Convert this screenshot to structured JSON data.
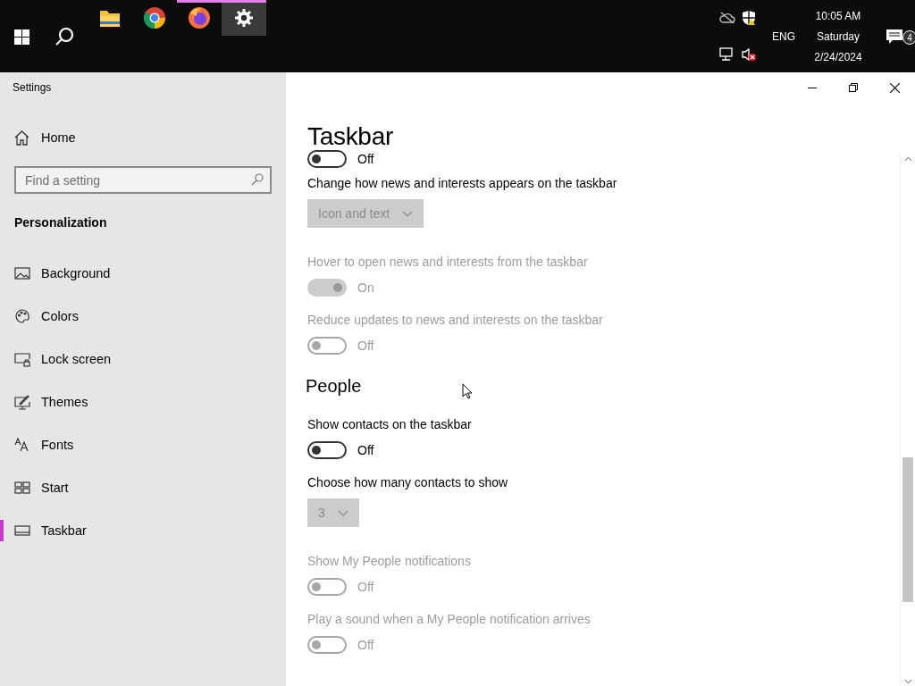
{
  "taskbar": {
    "apps": [
      {
        "kind": "explorer",
        "running": false,
        "active": false
      },
      {
        "kind": "chrome",
        "running": false,
        "active": false
      },
      {
        "kind": "firefox",
        "running": true,
        "active": false
      },
      {
        "kind": "settings",
        "running": true,
        "active": true
      }
    ],
    "tray": {
      "language": "ENG",
      "time": "10:05 AM",
      "day": "Saturday",
      "date": "2/24/2024",
      "notification_count": "4"
    }
  },
  "window": {
    "title": "Settings"
  },
  "sidebar": {
    "home": "Home",
    "search": {
      "placeholder": "Find a setting"
    },
    "section": "Personalization",
    "items": [
      {
        "kind": "background",
        "label": "Background",
        "selected": false
      },
      {
        "kind": "colors",
        "label": "Colors",
        "selected": false
      },
      {
        "kind": "lock",
        "label": "Lock screen",
        "selected": false
      },
      {
        "kind": "themes",
        "label": "Themes",
        "selected": false
      },
      {
        "kind": "fonts",
        "label": "Fonts",
        "selected": false
      },
      {
        "kind": "start",
        "label": "Start",
        "selected": false
      },
      {
        "kind": "taskbar",
        "label": "Taskbar",
        "selected": true
      }
    ]
  },
  "content": {
    "title": "Taskbar",
    "settings": [
      {
        "kind": "toggle",
        "on": false,
        "disabled": false,
        "state_text": "Off"
      },
      {
        "kind": "dropdown",
        "label": "Change how news and interests appears on the taskbar",
        "value": "Icon and text",
        "disabled": true
      },
      {
        "kind": "toggle",
        "label": "Hover to open news and interests from the taskbar",
        "on": true,
        "disabled": true,
        "state_text": "On"
      },
      {
        "kind": "toggle",
        "label": "Reduce updates to news and interests on the taskbar",
        "on": false,
        "disabled": true,
        "state_text": "Off"
      },
      {
        "kind": "heading",
        "label": "People"
      },
      {
        "kind": "toggle",
        "label": "Show contacts on the taskbar",
        "on": false,
        "disabled": false,
        "state_text": "Off"
      },
      {
        "kind": "dropdown",
        "label": "Choose how many contacts to show",
        "value": "3",
        "disabled": true
      },
      {
        "kind": "toggle",
        "label": "Show My People notifications",
        "on": false,
        "disabled": true,
        "state_text": "Off"
      },
      {
        "kind": "toggle",
        "label": "Play a sound when a My People notification arrives",
        "on": false,
        "disabled": true,
        "state_text": "Off"
      }
    ]
  }
}
